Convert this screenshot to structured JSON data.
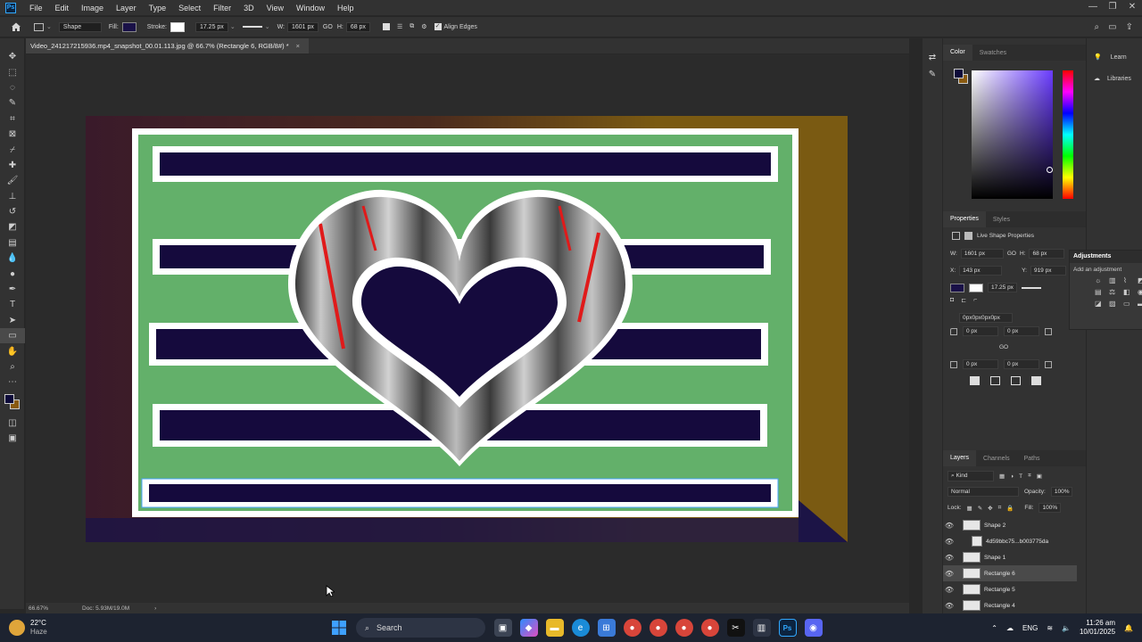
{
  "app": {
    "logo": "Ps",
    "menu": [
      "File",
      "Edit",
      "Image",
      "Layer",
      "Type",
      "Select",
      "Filter",
      "3D",
      "View",
      "Window",
      "Help"
    ],
    "window_controls": [
      "—",
      "❐",
      "✕"
    ]
  },
  "options_bar": {
    "tool_mode": "Shape",
    "fill_label": "Fill:",
    "stroke_label": "Stroke:",
    "stroke_width": "17.25 px",
    "width_label": "W:",
    "width_value": "1601 px",
    "link_icon": "GO",
    "height_label": "H:",
    "height_value": "68 px",
    "align_edges_label": "Align Edges",
    "fill_color": "#1a1148",
    "stroke_color": "#ffffff"
  },
  "document": {
    "tab_title": "Video_241217215936.mp4_snapshot_00.01.113.jpg @ 66.7% (Rectangle 6, RGB/8#) *",
    "close": "×",
    "zoom": "66.67%",
    "doc_size": "Doc: 5.93M/19.0M",
    "artwork_colors": {
      "green": "#63b06a",
      "navy": "#150a3d",
      "white": "#ffffff",
      "gold": "#7a5a12",
      "maroon": "#3a1a2a"
    }
  },
  "color_panel": {
    "tabs": [
      "Color",
      "Swatches"
    ],
    "foreground": "#0d0a3a",
    "background": "#8a5a10"
  },
  "learn_panel": {
    "items": [
      "Learn",
      "Libraries"
    ]
  },
  "properties_panel": {
    "tabs": [
      "Properties",
      "Styles"
    ],
    "section_title": "Live Shape Properties",
    "w_label": "W:",
    "w_value": "1601 px",
    "link_icon": "GO",
    "h_label": "H:",
    "h_value": "68 px",
    "x_label": "X:",
    "x_value": "143 px",
    "y_label": "Y:",
    "y_value": "919 px",
    "stroke_width": "17.25 px",
    "corner_summary": "0px0px0px0px",
    "corner_tl": "0 px",
    "corner_tr": "0 px",
    "corner_bl": "0 px",
    "corner_br": "0 px",
    "corner_link": "GO"
  },
  "adjustments_panel": {
    "title": "Adjustments",
    "subtitle": "Add an adjustment"
  },
  "layers_panel": {
    "tabs": [
      "Layers",
      "Channels",
      "Paths"
    ],
    "filter_label": "Kind",
    "blend_mode": "Normal",
    "opacity_label": "Opacity:",
    "opacity_value": "100%",
    "lock_label": "Lock:",
    "fill_label": "Fill:",
    "fill_value": "100%",
    "layers": [
      {
        "name": "Shape 2",
        "selected": false
      },
      {
        "name": "4d59bbc75...b003775da",
        "selected": false
      },
      {
        "name": "Shape 1",
        "selected": false
      },
      {
        "name": "Rectangle 6",
        "selected": true
      },
      {
        "name": "Rectangle 5",
        "selected": false
      },
      {
        "name": "Rectangle 4",
        "selected": false
      }
    ]
  },
  "taskbar": {
    "weather_temp": "22°C",
    "weather_desc": "Haze",
    "search_placeholder": "Search",
    "language": "ENG",
    "time": "11:26 am",
    "date": "10/01/2025"
  }
}
